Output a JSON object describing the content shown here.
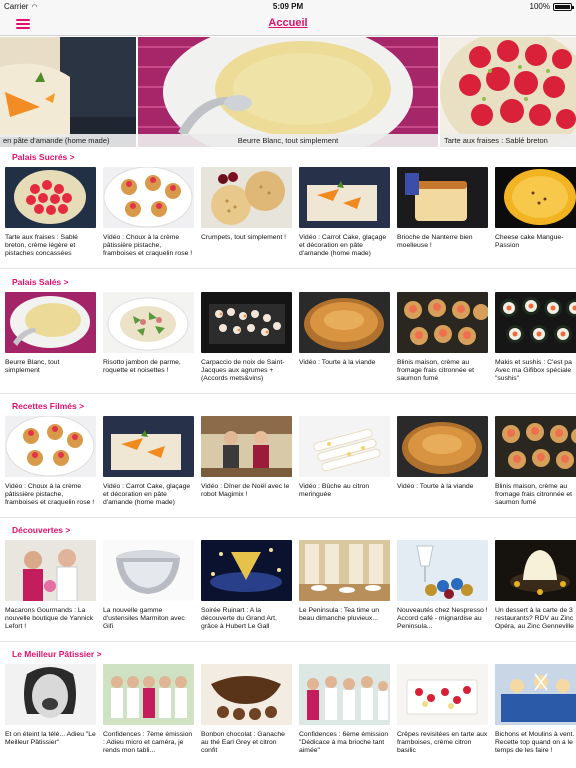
{
  "status_bar": {
    "carrier": "Carrier",
    "time": "5:09 PM",
    "battery": "100%"
  },
  "nav": {
    "title": "Accueil"
  },
  "hero": [
    {
      "caption": "en pâte d'amande (home made)"
    },
    {
      "caption": "Beurre Blanc, tout simplement"
    },
    {
      "caption": "Tarte aux fraises : Sablé breton"
    }
  ],
  "sections": [
    {
      "title": "Palais Sucrés >",
      "items": [
        {
          "caption": "Tarte aux fraises : Sablé breton, crème légère et pistaches concassées"
        },
        {
          "caption": "Vidéo : Choux à la crème pâtissière pistache, framboises et craquelin rose !"
        },
        {
          "caption": "Crumpets, tout simplement !"
        },
        {
          "caption": "Vidéo : Carrot Cake, glaçage et décoration en pâte d'amande (home made)"
        },
        {
          "caption": "Brioche de Nanterre bien moelleuse !"
        },
        {
          "caption": "Cheese cake Mangue-Passion"
        }
      ]
    },
    {
      "title": "Palais Salés >",
      "items": [
        {
          "caption": "Beurre Blanc, tout simplement"
        },
        {
          "caption": "Risotto jambon de parme, roquette et noisettes !"
        },
        {
          "caption": "Carpaccio de noix de Saint-Jacques aux agrumes + (Accords mets&vins)"
        },
        {
          "caption": "Vidéo : Tourte à la viande"
        },
        {
          "caption": "Blinis maison, crème au fromage frais citronnée et saumon fumé"
        },
        {
          "caption": "Makis et sushis : C'est pa Avec ma Gifibox spéciale \"sushis\""
        }
      ]
    },
    {
      "title": "Recettes Filmés >",
      "items": [
        {
          "caption": "Vidéo : Choux à la crème pâtissière pistache, framboises et craquelin rose !"
        },
        {
          "caption": "Vidéo : Carrot Cake, glaçage et décoration en pâte d'amande (home made)"
        },
        {
          "caption": "Vidéo : Dîner de Noël avec le robot Magimix !"
        },
        {
          "caption": "Vidéo : Bûche au citron meringuée"
        },
        {
          "caption": "Vidéo : Tourte à la viande"
        },
        {
          "caption": "Blinis maison, crème au fromage frais citronnée et saumon fumé"
        }
      ]
    },
    {
      "title": "Découvertes >",
      "items": [
        {
          "caption": "Macarons Gourmands : La nouvelle boutique de Yannick Lefort !"
        },
        {
          "caption": "La nouvelle gamme d'ustensiles Marmiton avec Gifi"
        },
        {
          "caption": "Soirée Ruinart : A la découverte du Grand Art, grâce à Hubert Le Gall"
        },
        {
          "caption": "Le Peninsula : Tea time un beau dimanche pluvieux..."
        },
        {
          "caption": "Nouveautés chez Nespresso ! Accord café - mignardise au Peninsula..."
        },
        {
          "caption": "Un dessert à la carte de 3 restaurants? RDV au Zinc Opéra, au Zinc Genneville"
        }
      ]
    },
    {
      "title": "Le Meilleur Pâtissier >",
      "items": [
        {
          "caption": "Et on éteint la télé... Adieu \"Le Meilleur Pâtissier\""
        },
        {
          "caption": "Confidences : 7ème émission : Adieu micro et caméra, je rends mon tabli..."
        },
        {
          "caption": "Bonbon chocolat : Ganache au thé Earl Grey et citron confit"
        },
        {
          "caption": "Confidences : 6ème émission \"Dédicace à ma brioche tant aimée\""
        },
        {
          "caption": "Crêpes revisitées en tarte aux framboises, crème citron basilic"
        },
        {
          "caption": "Bichons et Moulins à vent. Recette top quand on a le temps de les faire !"
        }
      ]
    }
  ]
}
